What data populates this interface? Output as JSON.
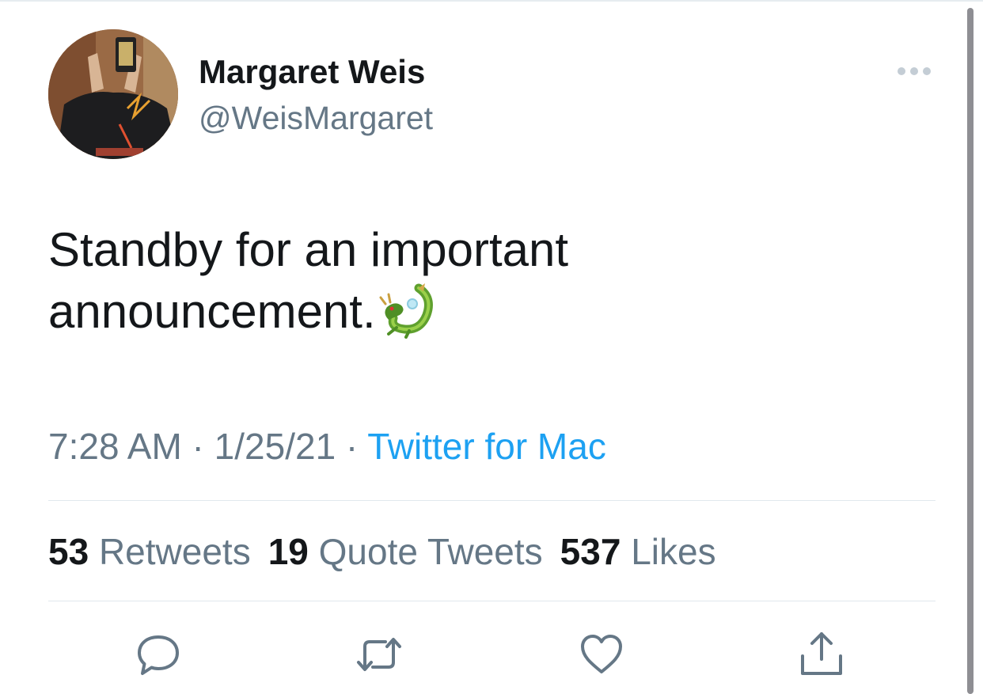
{
  "author": {
    "display_name": "Margaret Weis",
    "handle": "@WeisMargaret"
  },
  "tweet": {
    "text_line1": "Standby for an important",
    "text_line2": "announcement.",
    "emoji": "dragon-emoji"
  },
  "meta": {
    "time": "7:28 AM",
    "separator": " · ",
    "date": "1/25/21",
    "source": "Twitter for Mac"
  },
  "stats": [
    {
      "count": "53",
      "label": "Retweets"
    },
    {
      "count": "19",
      "label": "Quote Tweets"
    },
    {
      "count": "537",
      "label": "Likes"
    }
  ],
  "actions": [
    "reply-icon",
    "retweet-icon",
    "like-icon",
    "share-icon"
  ],
  "colors": {
    "primary_text": "#14171a",
    "secondary_text": "#657786",
    "link": "#1da1f2",
    "divider": "#e1e8ed"
  }
}
